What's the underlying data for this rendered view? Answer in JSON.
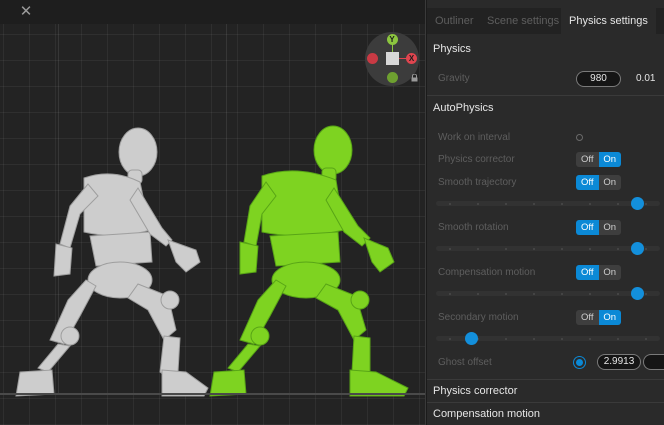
{
  "window": {
    "close_icon_glyph": "✕"
  },
  "gizmo": {
    "y_label": "Y",
    "x_label": "X"
  },
  "tabs": [
    {
      "label": "Outliner",
      "active": false
    },
    {
      "label": "Scene settings",
      "active": false
    },
    {
      "label": "Physics settings",
      "active": true
    }
  ],
  "physics": {
    "header": "Physics",
    "gravity_label": "Gravity",
    "gravity_value": "980",
    "gravity_step": "0.01"
  },
  "autophysics": {
    "header": "AutoPhysics",
    "work_on_interval_label": "Work on interval",
    "physics_corrector_label": "Physics corrector",
    "smooth_trajectory_label": "Smooth trajectory",
    "smooth_rotation_label": "Smooth rotation",
    "compensation_motion_label": "Compensation motion",
    "secondary_motion_label": "Secondary motion",
    "ghost_offset_label": "Ghost offset",
    "ghost_offset_value": "2.9913",
    "off_label": "Off",
    "on_label": "On",
    "physics_corrector_state": "On",
    "smooth_trajectory_state": "Off",
    "smooth_rotation_state": "Off",
    "compensation_motion_state": "Off",
    "secondary_motion_state": "On",
    "smooth_trajectory_level": 0.9,
    "smooth_rotation_level": 0.9,
    "compensation_motion_level": 0.9,
    "secondary_motion_level": 0.16
  },
  "sections": {
    "physics_corrector": "Physics corrector",
    "compensation_motion": "Compensation motion"
  },
  "colors": {
    "accent": "#0b89d6",
    "figure_gray": "#cfcfcf",
    "figure_green": "#7ed321"
  }
}
